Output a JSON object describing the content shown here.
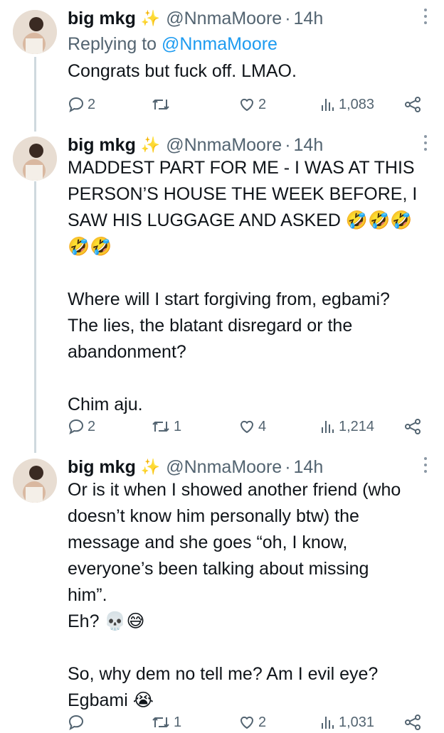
{
  "tweets": [
    {
      "name": "big mkg",
      "sparkle": "✨",
      "handle": "@NnmaMoore",
      "separator": "·",
      "time": "14h",
      "reply_prefix": "Replying to",
      "reply_to": "@NnmaMoore",
      "text": "Congrats but fuck off. LMAO.",
      "replies": "2",
      "retweets": "",
      "likes": "2",
      "views": "1,083"
    },
    {
      "name": "big mkg",
      "sparkle": "✨",
      "handle": "@NnmaMoore",
      "separator": "·",
      "time": "14h",
      "lines": [
        "MADDEST PART FOR ME - I WAS AT THIS",
        "PERSON’S HOUSE THE WEEK BEFORE, I",
        "SAW HIS LUGGAGE AND ASKED 🤣🤣🤣",
        "🤣🤣",
        "",
        "Where will I start forgiving from, egbami?",
        "The lies, the blatant disregard or the",
        "abandonment?",
        "",
        "Chim aju."
      ],
      "replies": "2",
      "retweets": "1",
      "likes": "4",
      "views": "1,214"
    },
    {
      "name": "big mkg",
      "sparkle": "✨",
      "handle": "@NnmaMoore",
      "separator": "·",
      "time": "14h",
      "lines": [
        "Or is it when I showed another friend (who",
        "doesn’t know him personally btw) the",
        "message and she goes “oh, I know,",
        "everyone’s been talking about missing",
        "him”.",
        "Eh? 💀😅",
        "",
        "So, why dem no tell me? Am I evil eye?",
        "Egbami 😭"
      ],
      "replies": "",
      "retweets": "1",
      "likes": "2",
      "views": "1,031"
    }
  ],
  "icons": {
    "reply": "reply-icon",
    "retweet": "retweet-icon",
    "like": "heart-icon",
    "views": "views-icon",
    "share": "share-icon",
    "more": "more-icon"
  },
  "colors": {
    "text": "#0f1419",
    "secondary": "#536471",
    "link": "#1d9bf0",
    "thread_line": "#cfd9de"
  }
}
